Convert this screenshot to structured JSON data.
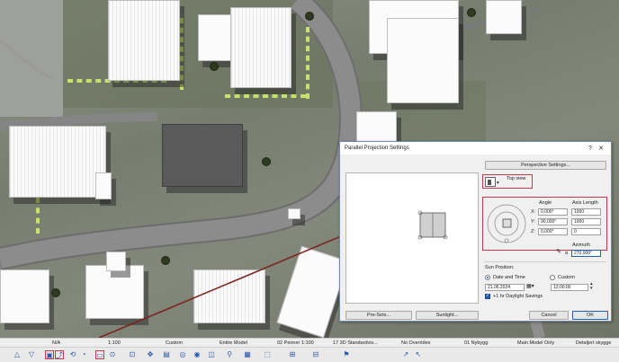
{
  "dialog": {
    "title": "Parallel Projection Settings",
    "help_glyph": "?",
    "close_glyph": "✕",
    "perspective_button": "Perspective Settings...",
    "view_name": "Top view",
    "angle_header": "Angle",
    "axis_header": "Axis Length",
    "axes": [
      {
        "label": "X:",
        "angle": "0,000°",
        "length": "1000"
      },
      {
        "label": "Y:",
        "angle": "90,000°",
        "length": "1000"
      },
      {
        "label": "Z:",
        "angle": "0,000°",
        "length": "0"
      }
    ],
    "azimuth_label": "Azimuth",
    "azimuth_prefix": "α",
    "azimuth_value": "270,000°",
    "sun_position_label": "Sun Position:",
    "radio_date_time": "Date and Time",
    "radio_custom": "Custom",
    "date_value": "21.06.2024",
    "time_value": "12:00:00",
    "daylight_savings": "+1 hr Daylight Savings",
    "presets_button": "Pre-Sets...",
    "sunlight_button": "Sunlight...",
    "cancel_button": "Cancel",
    "ok_button": "OK"
  },
  "status_bar": {
    "na": "N/A",
    "scale": "1:100",
    "custom": "Custom",
    "entire_model": "Entire Model",
    "pens": "02 Penner 1:100",
    "standard": "17 3D Standardvis...",
    "overrides": "No Overrides",
    "layer": "01 Nybygg",
    "model_option": "Main Model Only",
    "shadow": "Detaljert skygge"
  },
  "icons": {
    "preview_view": "floor-plan-preview-icon",
    "view_box": "top-view-box-icon",
    "compass": "azimuth-compass-icon",
    "calendar": "calendar-icon",
    "spinner": "time-spinner-icon"
  },
  "colors": {
    "highlight": "#c33b4b",
    "link_line": "#7a2320",
    "dialog_border": "#6e89b3"
  }
}
